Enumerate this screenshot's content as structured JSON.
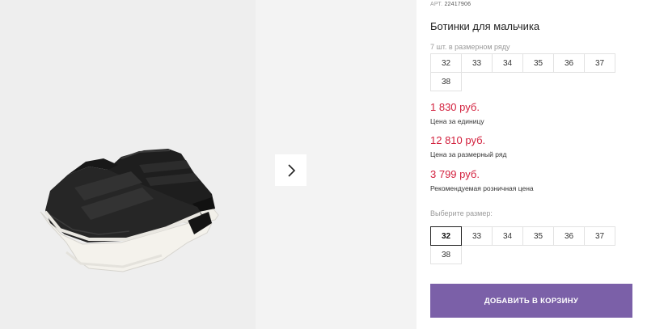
{
  "product": {
    "sku_label": "АРТ.",
    "sku": "22417906",
    "title": "Ботинки для мальчика"
  },
  "pack": {
    "caption": "7 шт. в размерном ряду",
    "sizes": [
      "32",
      "33",
      "34",
      "35",
      "36",
      "37",
      "38"
    ]
  },
  "prices": {
    "unit_price": "1 830 руб.",
    "unit_label": "Цена за единицу",
    "set_price": "12 810 руб.",
    "set_label": "Цена за размерный ряд",
    "retail_price": "3 799 руб.",
    "retail_label": "Рекомендуемая розничная цена"
  },
  "size_picker": {
    "caption": "Выберите размер:",
    "sizes": [
      "32",
      "33",
      "34",
      "35",
      "36",
      "37",
      "38"
    ],
    "selected": "32"
  },
  "add_to_cart_label": "ДОБАВИТЬ В КОРЗИНУ",
  "colors": {
    "price": "#d21f3c",
    "button": "#7b60a8"
  },
  "icons": {
    "next": "chevron-right-icon"
  }
}
